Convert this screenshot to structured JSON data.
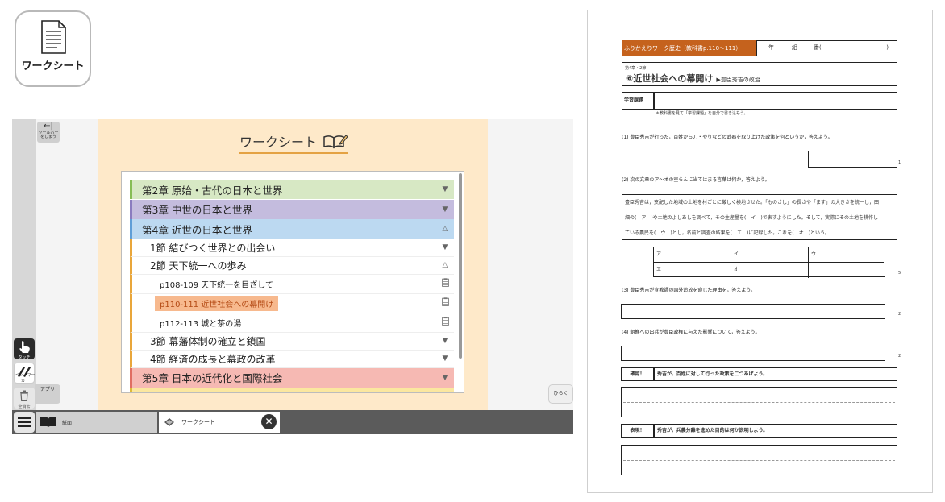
{
  "icon": {
    "label": "ワークシート",
    "icon": "document-icon"
  },
  "toolbar": {
    "hide_label": "←|",
    "hide_sub": "ツールバーをしまう",
    "touch_caption": "タッチ",
    "pen_caption": "ペン・マーカー",
    "eraser_caption": "全消去",
    "app_label": "アプリ",
    "open_label": "ひらく"
  },
  "panel": {
    "title": "ワークシート",
    "title_icon": "open-book-pencil-icon",
    "rows": [
      {
        "kind": "chapter",
        "cls": "ch2",
        "label": "第2章  原始・古代の日本と世界",
        "end": "▼"
      },
      {
        "kind": "chapter",
        "cls": "ch3",
        "label": "第3章  中世の日本と世界",
        "end": "▼"
      },
      {
        "kind": "chapter",
        "cls": "ch4",
        "label": "第4章  近世の日本と世界",
        "end": "△"
      },
      {
        "kind": "section",
        "label": "1節  結びつく世界との出会い",
        "end": "▼"
      },
      {
        "kind": "section",
        "label": "2節  天下統一への歩み",
        "end": "△"
      },
      {
        "kind": "page",
        "label": "p108-109  天下統一を目ざして",
        "end": "doc"
      },
      {
        "kind": "page",
        "active": true,
        "label": "p110-111  近世社会への幕開け",
        "end": "doc"
      },
      {
        "kind": "page",
        "label": "p112-113  城と茶の湯",
        "end": "doc"
      },
      {
        "kind": "section",
        "label": "3節  幕藩体制の確立と鎖国",
        "end": "▼"
      },
      {
        "kind": "section",
        "label": "4節  経済の成長と幕政の改革",
        "end": "▼"
      },
      {
        "kind": "chapter",
        "cls": "ch5",
        "label": "第5章  日本の近代化と国際社会",
        "end": "▼"
      },
      {
        "kind": "chapter",
        "cls": "ch6",
        "label": "",
        "end": ""
      }
    ]
  },
  "tabs": {
    "textbook": "紙面",
    "worksheet": "ワークシート",
    "close": "✕"
  },
  "doc": {
    "header_title": "ふりかえりワーク歴史（教科書p.110〜111）",
    "class_label": "年",
    "group_label": "組",
    "number_label": "番(",
    "close_paren": ")",
    "chapter_small": "第4章・2節",
    "lesson_title": "⑥近世社会への幕開け",
    "lesson_sub": "▶豊臣秀吉の政治",
    "theme_label": "学習課題",
    "theme_note": "＊教科書を見て「学習課題」を自分で書き込もう。",
    "q1": "(1) 豊臣秀吉が行った，百姓から刀・やりなどの武器を取り上げた政策を何というか，答えよう。",
    "q1_pt": "1",
    "q2": "(2) 次の文章のア〜オの空らんに当てはまる言葉は何か，答えよう。",
    "q2_text_lines": [
      "豊臣秀吉は，支配した地域の土地を村ごとに厳しく検地させた。「ものさし」の長さや「ます」の大きさを統一し，田",
      "畑の(　ア　)や土地のよしあしを調べて，その生産量を(　イ　)で表すようにした。そして，実際にその土地を耕作し",
      "ている農民を(　ウ　)とし，名前と調査の結果を(　エ　)に記録した。これを(　オ　)という。"
    ],
    "grid": [
      "ア",
      "イ",
      "ウ",
      "エ",
      "オ"
    ],
    "q2_pt": "5",
    "q3": "(3) 豊臣秀吉が宣教師の国外追放を命じた理由を，答えよう。",
    "q3_pt": "2",
    "q4": "(4) 朝鮮への出兵が豊臣政権に与えた影響について，答えよう。",
    "q4_pt": "2",
    "confirm_label": "確認！",
    "confirm_task": "秀吉が，百姓に対して行った政策を二つあげよう。",
    "express_label": "表現！",
    "express_task": "秀吉が，兵農分離を進めた目的は何か説明しよう。"
  }
}
